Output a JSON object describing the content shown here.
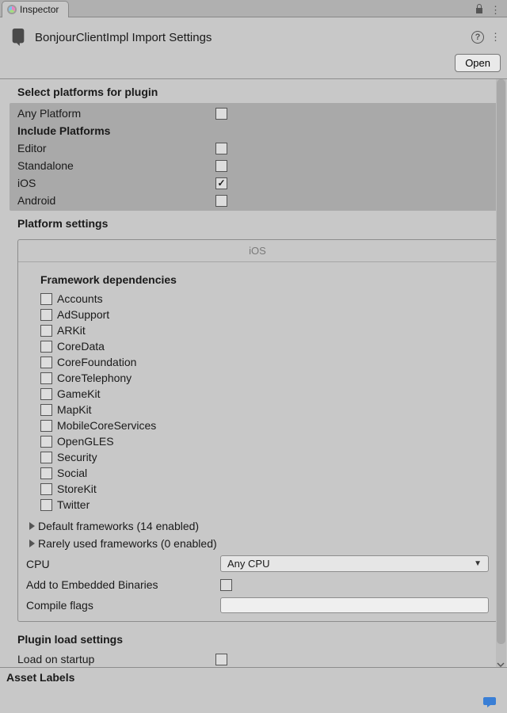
{
  "tab": {
    "label": "Inspector"
  },
  "header": {
    "title": "BonjourClientImpl Import Settings",
    "open_label": "Open"
  },
  "platforms_section": {
    "title": "Select platforms for plugin",
    "any_label": "Any Platform",
    "include_label": "Include Platforms",
    "items": [
      {
        "label": "Editor",
        "checked": false
      },
      {
        "label": "Standalone",
        "checked": false
      },
      {
        "label": "iOS",
        "checked": true
      },
      {
        "label": "Android",
        "checked": false
      }
    ]
  },
  "platform_settings": {
    "title": "Platform settings",
    "tab_label": "iOS",
    "frameworks_title": "Framework dependencies",
    "frameworks": [
      "Accounts",
      "AdSupport",
      "ARKit",
      "CoreData",
      "CoreFoundation",
      "CoreTelephony",
      "GameKit",
      "MapKit",
      "MobileCoreServices",
      "OpenGLES",
      "Security",
      "Social",
      "StoreKit",
      "Twitter"
    ],
    "default_foldout": "Default frameworks (14 enabled)",
    "rarely_foldout": "Rarely used frameworks (0 enabled)",
    "cpu_label": "CPU",
    "cpu_value": "Any CPU",
    "embedded_label": "Add to Embedded Binaries",
    "compile_label": "Compile flags"
  },
  "plugin_load": {
    "title": "Plugin load settings",
    "startup_label": "Load on startup"
  },
  "footer": {
    "asset_labels": "Asset Labels"
  }
}
